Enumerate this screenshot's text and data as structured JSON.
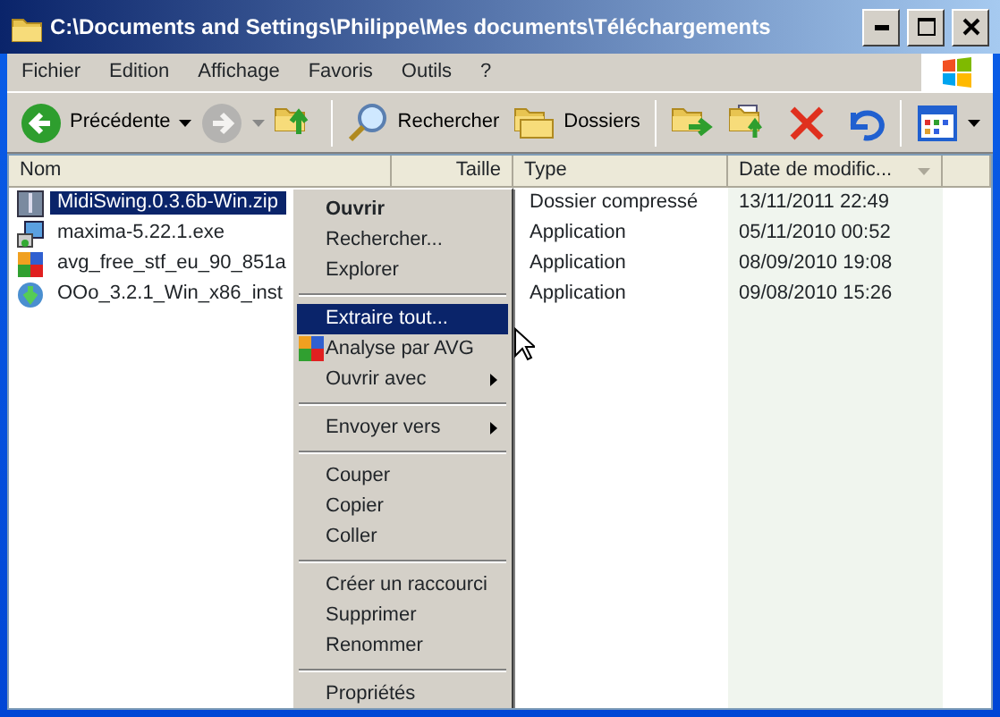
{
  "window": {
    "title": "C:\\Documents and Settings\\Philippe\\Mes documents\\Téléchargements"
  },
  "menu_bar": [
    "Fichier",
    "Edition",
    "Affichage",
    "Favoris",
    "Outils",
    "?"
  ],
  "toolbar": [
    {
      "kind": "back",
      "label": "Précédente",
      "disabled": false
    },
    {
      "kind": "forward",
      "disabled": true
    },
    {
      "kind": "up"
    },
    {
      "kind": "search",
      "label": "Rechercher"
    },
    {
      "kind": "folders",
      "label": "Dossiers"
    },
    {
      "kind": "move"
    },
    {
      "kind": "copy"
    },
    {
      "kind": "delete"
    },
    {
      "kind": "undo"
    },
    {
      "kind": "views"
    }
  ],
  "columns": [
    {
      "label": "Nom",
      "sorted": false
    },
    {
      "label": "Taille",
      "sorted": false
    },
    {
      "label": "Type",
      "sorted": false
    },
    {
      "label": "Date de modific...",
      "sorted": true
    }
  ],
  "rows": [
    {
      "kind": "zip",
      "name": "MidiSwing.0.3.6b-Win.zip",
      "type": "Dossier compressé",
      "date": "13/11/2011 22:49",
      "selected": true
    },
    {
      "kind": "exe",
      "name": "maxima-5.22.1.exe",
      "type": "Application",
      "date": "05/11/2010 00:52",
      "selected": false
    },
    {
      "kind": "avg",
      "name": "avg_free_stf_eu_90_851a",
      "type": "Application",
      "date": "08/09/2010 19:08",
      "selected": false
    },
    {
      "kind": "setup",
      "name": "OOo_3.2.1_Win_x86_inst",
      "type": "Application",
      "date": "09/08/2010 15:26",
      "selected": false
    }
  ],
  "context_menu": [
    {
      "kind": "item",
      "label": "Ouvrir",
      "default": true,
      "selected": false
    },
    {
      "kind": "item",
      "label": "Rechercher...",
      "selected": false
    },
    {
      "kind": "item",
      "label": "Explorer",
      "selected": false
    },
    {
      "kind": "separator"
    },
    {
      "kind": "item",
      "label": "Extraire tout...",
      "selected": true
    },
    {
      "kind": "item",
      "label": "Analyse par AVG",
      "icon": true,
      "selected": false
    },
    {
      "kind": "item",
      "label": "Ouvrir avec",
      "submenu": true,
      "selected": false
    },
    {
      "kind": "separator"
    },
    {
      "kind": "item",
      "label": "Envoyer vers",
      "submenu": true,
      "selected": false
    },
    {
      "kind": "separator"
    },
    {
      "kind": "item",
      "label": "Couper",
      "selected": false
    },
    {
      "kind": "item",
      "label": "Copier",
      "selected": false
    },
    {
      "kind": "item",
      "label": "Coller",
      "selected": false
    },
    {
      "kind": "separator"
    },
    {
      "kind": "item",
      "label": "Créer un raccourci",
      "selected": false
    },
    {
      "kind": "item",
      "label": "Supprimer",
      "selected": false
    },
    {
      "kind": "item",
      "label": "Renommer",
      "selected": false
    },
    {
      "kind": "separator"
    },
    {
      "kind": "item",
      "label": "Propriétés",
      "selected": false
    }
  ]
}
